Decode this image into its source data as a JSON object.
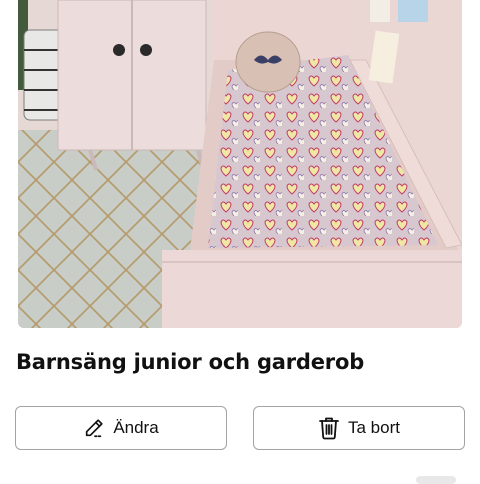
{
  "listing": {
    "title": "Barnsäng junior och garderob",
    "photo_subject": "room-with-bed-and-wardrobe",
    "icon": "photo"
  },
  "actions": {
    "edit": {
      "label": "Ändra",
      "icon": "pencil-icon"
    },
    "delete": {
      "label": "Ta bort",
      "icon": "trash-icon"
    }
  },
  "colors": {
    "text": "#111111",
    "button_border": "#a3a3a3",
    "background": "#ffffff"
  }
}
